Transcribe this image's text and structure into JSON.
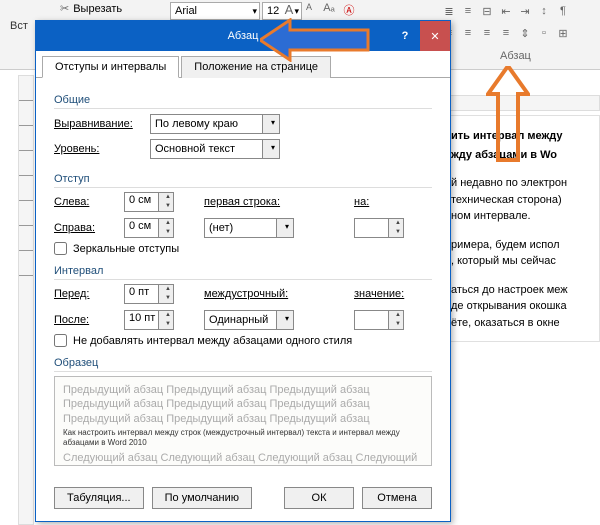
{
  "ribbon": {
    "cut": "Вырезать",
    "paste": "Вст",
    "font": "Arial",
    "size": "12",
    "para_label": "Абзац"
  },
  "dialog": {
    "title": "Абзац",
    "tabs": {
      "intervals": "Отступы и интервалы",
      "page": "Положение на странице"
    },
    "general": {
      "header": "Общие",
      "alignment_label": "Выравнивание:",
      "alignment_value": "По левому краю",
      "level_label": "Уровень:",
      "level_value": "Основной текст"
    },
    "indent": {
      "header": "Отступ",
      "left_label": "Слева:",
      "left_value": "0 см",
      "right_label": "Справа:",
      "right_value": "0 см",
      "first_line_label": "первая строка:",
      "first_line_value": "(нет)",
      "by_label": "на:",
      "by_value": "",
      "mirror": "Зеркальные отступы"
    },
    "spacing": {
      "header": "Интервал",
      "before_label": "Перед:",
      "before_value": "0 пт",
      "after_label": "После:",
      "after_value": "10 пт",
      "line_label": "междустрочный:",
      "line_value": "Одинарный",
      "at_label": "значение:",
      "at_value": "",
      "nospace": "Не добавлять интервал между абзацами одного стиля"
    },
    "preview": {
      "header": "Образец",
      "prev": "Предыдущий абзац Предыдущий абзац Предыдущий абзац Предыдущий абзац Предыдущий абзац Предыдущий абзац Предыдущий абзац Предыдущий абзац Предыдущий абзац",
      "cur": "Как настроить интервал между строк (междустрочный интервал) текста и интервал между абзацами в Word 2010",
      "next": "Следующий абзац Следующий абзац Следующий абзац Следующий абзац Следующий абзац Следующий абзац Следующий абзац Следующий абзац Следующий абзац"
    },
    "buttons": {
      "tabs_btn": "Табуляция...",
      "default_btn": "По умолчанию",
      "ok": "ОК",
      "cancel": "Отмена"
    }
  },
  "doc": {
    "h1a": "ить интервал между",
    "h1b": "жду абзацами в Wo",
    "p1a": "й недавно по электрон",
    "p1b": "техническая сторона)",
    "p1c": "ном интервале.",
    "p2a": "римера, будем испол",
    "p2b": ", который мы сейчас",
    "p3a": "аться до настроек меж",
    "p3b": "де открывания окошка",
    "p3c": "ёте, оказаться в окне"
  },
  "icons": {
    "aa_plus": "A",
    "aa_case": "Aa",
    "clear_fmt": "A"
  }
}
